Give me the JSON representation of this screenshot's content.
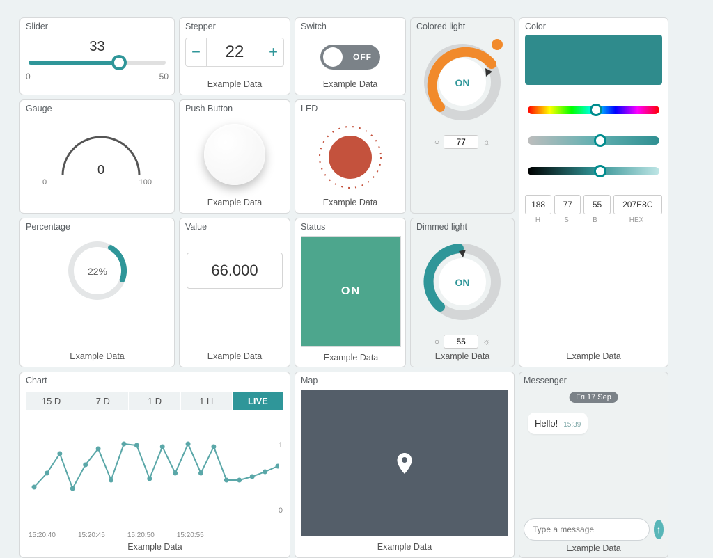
{
  "captions": {
    "example": "Example Data"
  },
  "slider": {
    "title": "Slider",
    "value": 33,
    "min": 0,
    "max": 50,
    "fill_pct": "66%"
  },
  "stepper": {
    "title": "Stepper",
    "value": 22
  },
  "switch": {
    "title": "Switch",
    "label": "OFF",
    "on": false
  },
  "gauge": {
    "title": "Gauge",
    "value": 0,
    "min": 0,
    "max": 100
  },
  "pushbtn": {
    "title": "Push Button"
  },
  "led": {
    "title": "LED",
    "color": "#c4523d"
  },
  "colored_light": {
    "title": "Colored light",
    "value": 77,
    "status": "ON",
    "dot_color": "#f18a2b"
  },
  "dimmed_light": {
    "title": "Dimmed light",
    "value": 55,
    "status": "ON"
  },
  "percentage": {
    "title": "Percentage",
    "value": "22%",
    "fraction": 0.22
  },
  "value": {
    "title": "Value",
    "value": "66.000"
  },
  "status": {
    "title": "Status",
    "label": "ON"
  },
  "color": {
    "title": "Color",
    "swatch": "#2f8b8c",
    "h": 188,
    "s": 77,
    "b": 55,
    "hex": "207E8C",
    "labels": {
      "h": "H",
      "s": "S",
      "b": "B",
      "hex": "HEX"
    }
  },
  "chart": {
    "title": "Chart",
    "tabs": [
      "15 D",
      "7 D",
      "1 D",
      "1 H",
      "LIVE"
    ],
    "active_tab": "LIVE",
    "xticks": [
      "15:20:40",
      "15:20:45",
      "15:20:50",
      "15:20:55"
    ],
    "yticks": [
      "1",
      "0"
    ]
  },
  "map": {
    "title": "Map"
  },
  "messenger": {
    "title": "Messenger",
    "date": "Fri 17 Sep",
    "message": "Hello!",
    "time": "15:39",
    "placeholder": "Type a message"
  },
  "chart_data": {
    "type": "line",
    "title": "Example Data",
    "xlabel": "",
    "ylabel": "",
    "ylim": [
      0,
      1
    ],
    "x": [
      "15:20:40",
      "15:20:41",
      "15:20:42",
      "15:20:43",
      "15:20:44",
      "15:20:45",
      "15:20:46",
      "15:20:47",
      "15:20:48",
      "15:20:49",
      "15:20:50",
      "15:20:51",
      "15:20:52",
      "15:20:53",
      "15:20:54",
      "15:20:55",
      "15:20:56",
      "15:20:57",
      "15:20:58",
      "15:20:59"
    ],
    "values": [
      0.3,
      0.5,
      0.78,
      0.28,
      0.62,
      0.85,
      0.4,
      0.92,
      0.9,
      0.42,
      0.88,
      0.5,
      0.92,
      0.5,
      0.88,
      0.4,
      0.4,
      0.45,
      0.52,
      0.6
    ]
  }
}
